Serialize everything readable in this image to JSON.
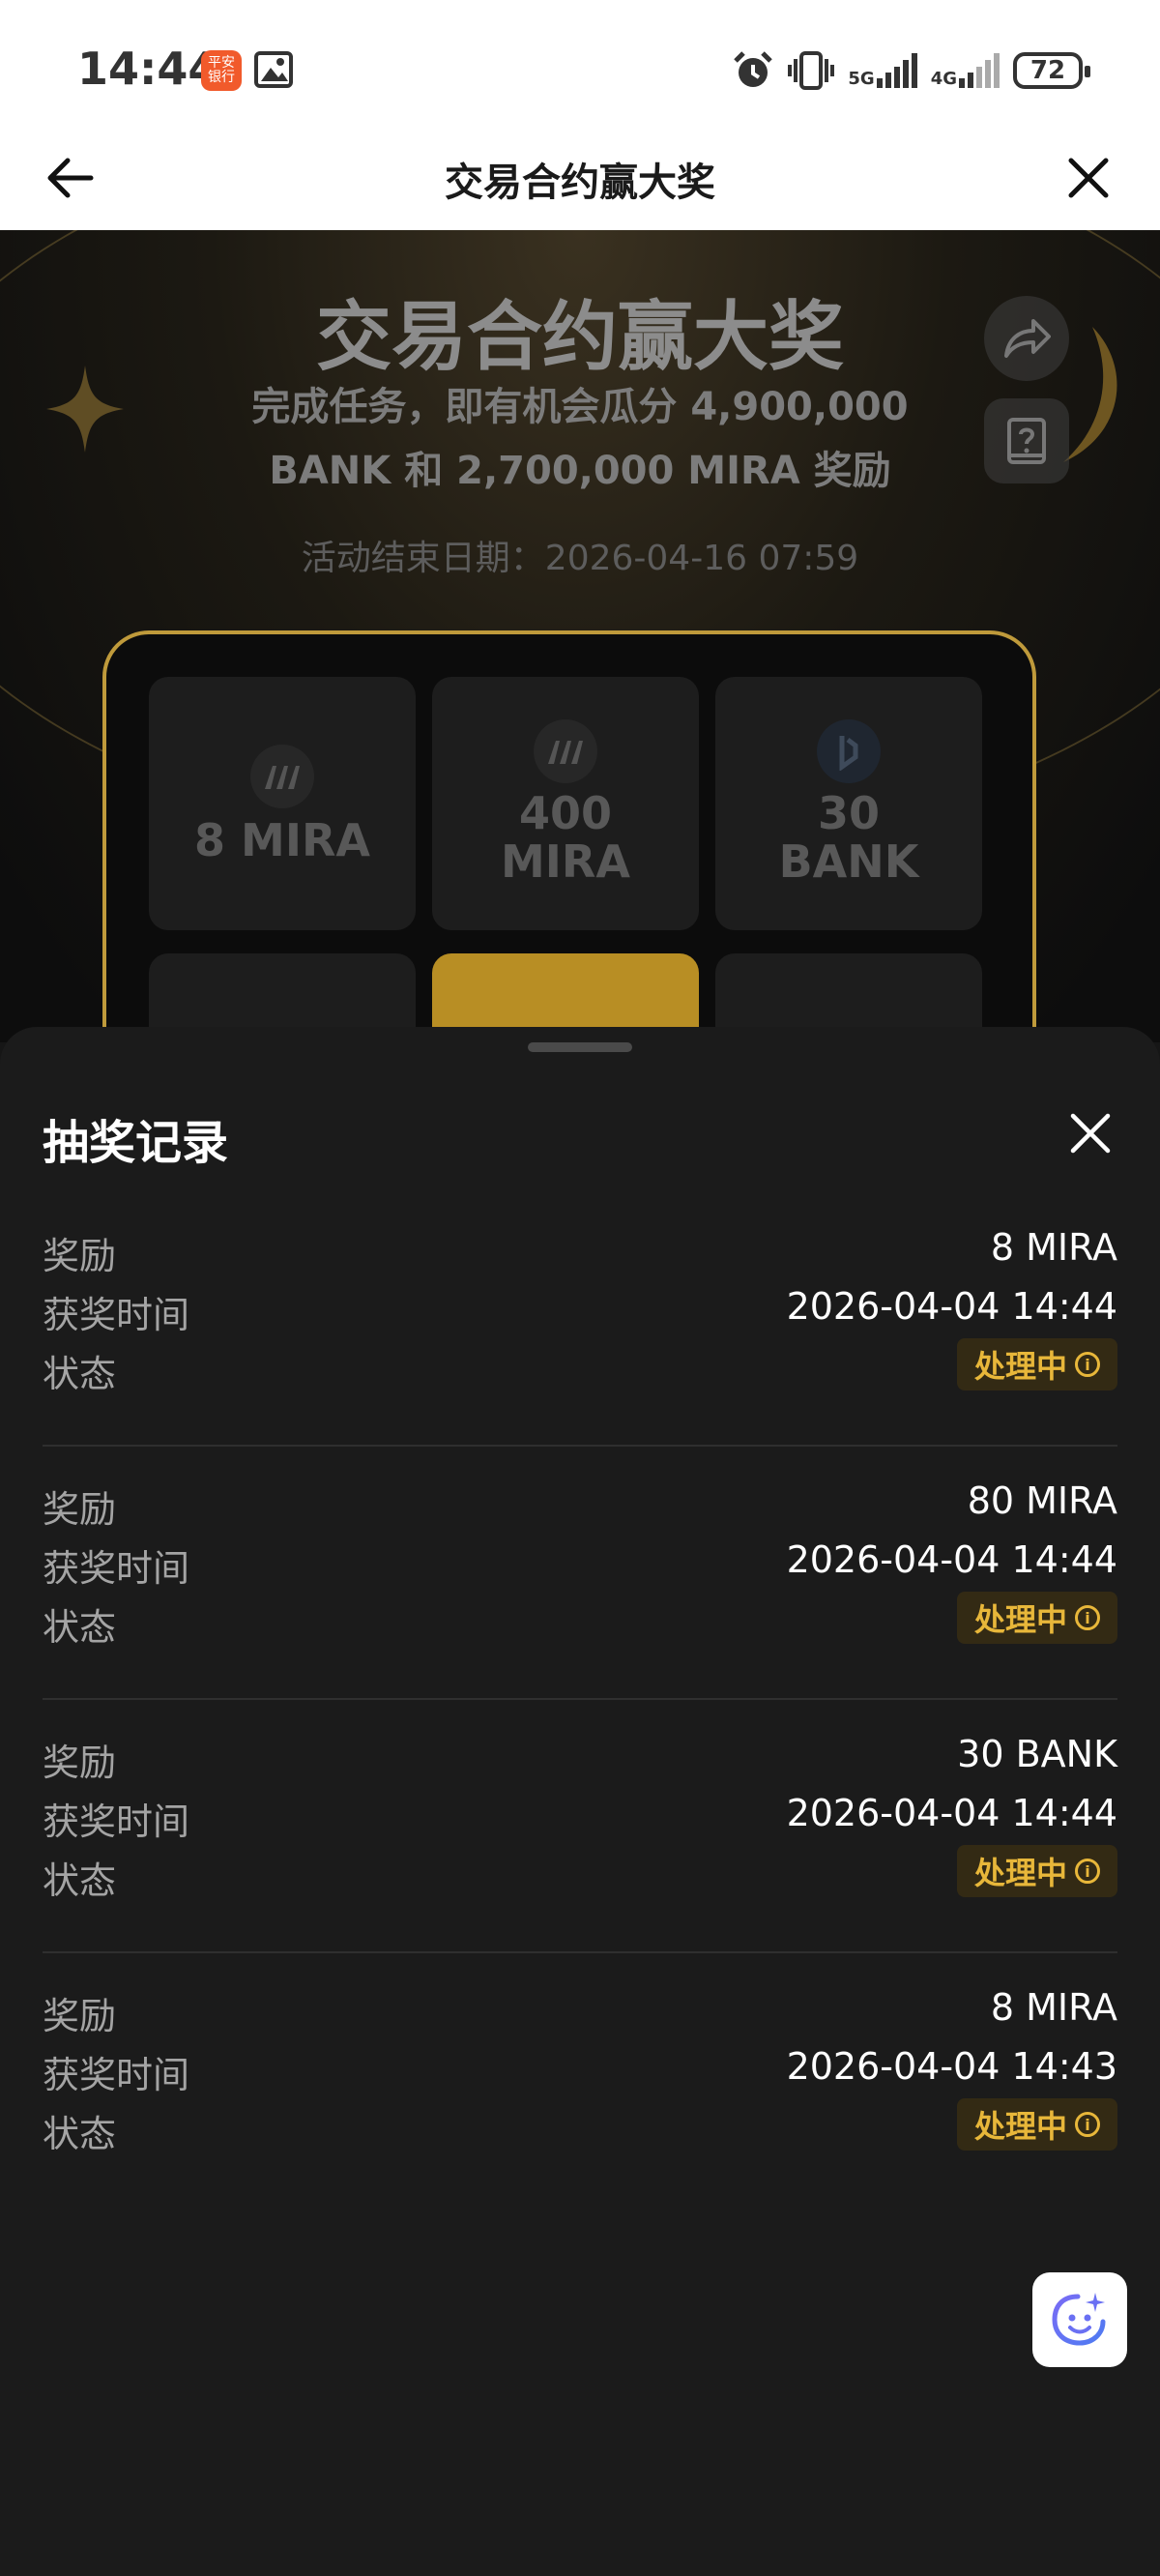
{
  "status_bar": {
    "time": "14:44",
    "app_badge": "平安\n银行",
    "battery": "72",
    "net1": "5G",
    "net2": "4G"
  },
  "header": {
    "title": "交易合约赢大奖"
  },
  "promo": {
    "title": "交易合约赢大奖",
    "subtitle": "完成任务，即有机会瓜分 4,900,000 BANK 和 2,700,000 MIRA 奖励",
    "end_date": "活动结束日期：2026-04-16 07:59",
    "cells": [
      {
        "label": "8 MIRA",
        "icon": "mira-logo-icon"
      },
      {
        "label": "400\nMIRA",
        "icon": "mira-logo-icon"
      },
      {
        "label": "30\nBANK",
        "icon": "bank-logo-icon"
      }
    ]
  },
  "sheet": {
    "title": "抽奖记录",
    "labels": {
      "reward": "奖励",
      "time": "获奖时间",
      "status": "状态"
    },
    "records": [
      {
        "reward": "8 MIRA",
        "time": "2026-04-04 14:44",
        "status": "处理中"
      },
      {
        "reward": "80 MIRA",
        "time": "2026-04-04 14:44",
        "status": "处理中"
      },
      {
        "reward": "30 BANK",
        "time": "2026-04-04 14:44",
        "status": "处理中"
      },
      {
        "reward": "8 MIRA",
        "time": "2026-04-04 14:43",
        "status": "处理中"
      }
    ]
  },
  "colors": {
    "accent": "#e8b73a",
    "badge_bg": "#332a14",
    "sheet_bg": "#1b1b1b",
    "grid_border": "#bf9a3b"
  }
}
